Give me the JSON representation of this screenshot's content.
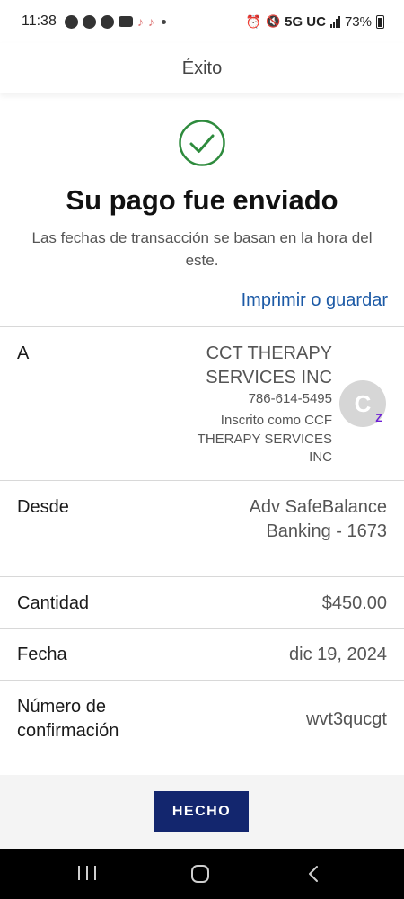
{
  "status_bar": {
    "time": "11:38",
    "network": "5G UC",
    "battery": "73%"
  },
  "header": {
    "title": "Éxito"
  },
  "success": {
    "icon": "check-circle-icon",
    "title": "Su pago fue enviado",
    "subtitle": "Las fechas de transacción se basan en la hora del este.",
    "print_link": "Imprimir o guardar"
  },
  "details": {
    "to": {
      "label": "A",
      "name": "CCT THERAPY SERVICES INC",
      "phone": "786-614-5495",
      "enrolled": "Inscrito como CCF THERAPY SERVICES INC",
      "avatar_letter": "C",
      "badge": "Z"
    },
    "from": {
      "label": "Desde",
      "value": "Adv SafeBalance Banking - 1673"
    },
    "amount": {
      "label": "Cantidad",
      "value": "$450.00"
    },
    "date": {
      "label": "Fecha",
      "value": "dic 19, 2024"
    },
    "confirmation": {
      "label": "Número de confirmación",
      "value": "wvt3qucgt"
    }
  },
  "footer": {
    "done_label": "HECHO"
  },
  "colors": {
    "accent_link": "#1c5aa6",
    "success_green": "#2e8b3d",
    "button_navy": "#13266e",
    "zelle_purple": "#6d1ed4"
  }
}
